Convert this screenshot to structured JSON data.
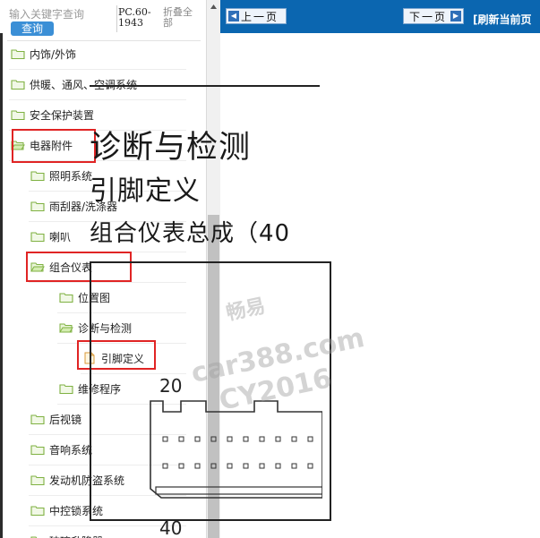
{
  "search": {
    "placeholder": "输入关键字查询",
    "button": "查询",
    "pc_label": "PC.60-1943",
    "collapse_all": "折叠全部"
  },
  "tree": [
    {
      "label": "内饰/外饰",
      "level": 0,
      "icon": "folder-icon"
    },
    {
      "label": "供暖、通风、空调系统",
      "level": 0,
      "icon": "folder-icon"
    },
    {
      "label": "安全保护装置",
      "level": 0,
      "icon": "folder-icon"
    },
    {
      "label": "电器附件",
      "level": 0,
      "icon": "folder-open-icon",
      "highlighted": true
    },
    {
      "label": "照明系统",
      "level": 1,
      "icon": "folder-icon"
    },
    {
      "label": "雨刮器/洗涤器",
      "level": 1,
      "icon": "folder-icon"
    },
    {
      "label": "喇叭",
      "level": 1,
      "icon": "folder-icon"
    },
    {
      "label": "组合仪表",
      "level": 1,
      "icon": "folder-open-icon",
      "highlighted": true
    },
    {
      "label": "位置图",
      "level": 2,
      "icon": "folder-icon"
    },
    {
      "label": "诊断与检测",
      "level": 2,
      "icon": "folder-open-icon"
    },
    {
      "label": "引脚定义",
      "level": 3,
      "icon": "document-icon",
      "highlighted": true,
      "selected": true
    },
    {
      "label": "维修程序",
      "level": 2,
      "icon": "folder-icon"
    },
    {
      "label": "后视镜",
      "level": 1,
      "icon": "folder-icon"
    },
    {
      "label": "音响系统",
      "level": 1,
      "icon": "folder-icon"
    },
    {
      "label": "发动机防盗系统",
      "level": 1,
      "icon": "folder-icon"
    },
    {
      "label": "中控锁系统",
      "level": 1,
      "icon": "folder-icon"
    },
    {
      "label": "玻璃升降器",
      "level": 1,
      "icon": "folder-icon"
    }
  ],
  "toolbar": {
    "prev": "上一页",
    "next": "下一页",
    "refresh": "[刷新当前页"
  },
  "document": {
    "heading1": "诊断与检测",
    "heading2": "引脚定义",
    "heading3": "组合仪表总成（40",
    "pin_label_top": "20",
    "pin_label_bottom": "40"
  },
  "watermark": {
    "line1": "畅易",
    "line2": "car388.com",
    "line3": "CY2016"
  },
  "colors": {
    "toolbar": "#0b66b0",
    "search_button": "#3b8fd6",
    "highlight_box": "#e02424",
    "folder": "#7fb142"
  }
}
